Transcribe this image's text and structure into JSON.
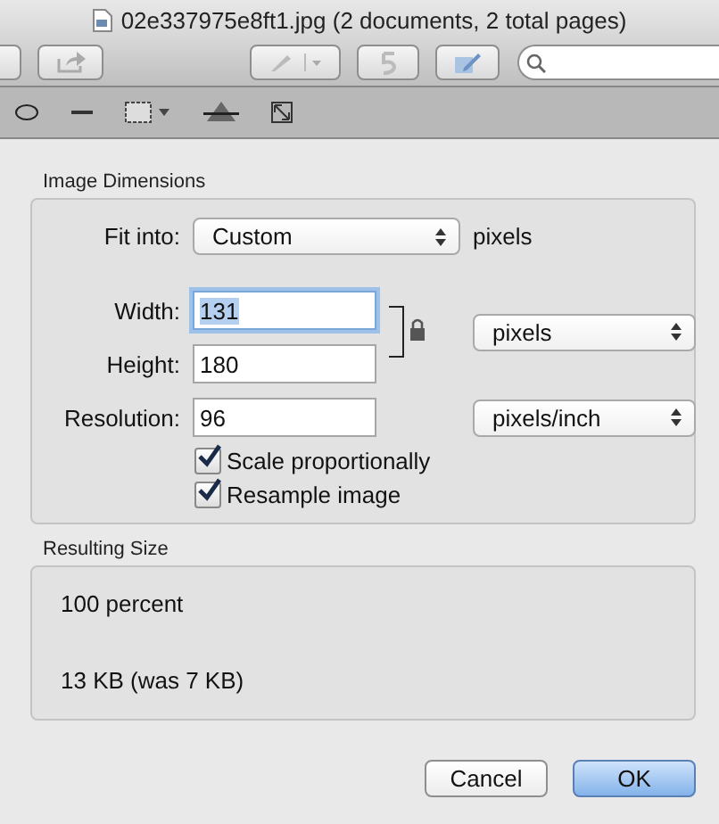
{
  "window": {
    "title": "02e337975e8ft1.jpg (2 documents, 2 total pages)"
  },
  "dimensions": {
    "heading": "Image Dimensions",
    "fit_label": "Fit into:",
    "fit_value": "Custom",
    "fit_unit": "pixels",
    "width_label": "Width:",
    "width_value": "131",
    "width_focused": true,
    "height_label": "Height:",
    "height_value": "180",
    "size_unit": "pixels",
    "resolution_label": "Resolution:",
    "resolution_value": "96",
    "resolution_unit": "pixels/inch",
    "options": [
      {
        "label": "Scale proportionally",
        "checked": true
      },
      {
        "label": "Resample image",
        "checked": true
      }
    ]
  },
  "result": {
    "heading": "Resulting Size",
    "percent": "100 percent",
    "size": "13 KB (was 7 KB)"
  },
  "buttons": [
    {
      "label": "Cancel",
      "default": false
    },
    {
      "label": "OK",
      "default": true
    }
  ]
}
